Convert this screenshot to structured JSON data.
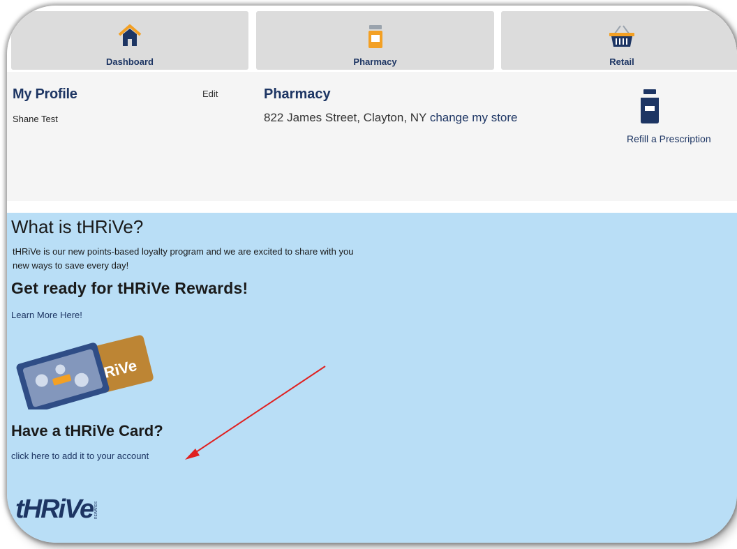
{
  "nav": {
    "dashboard": "Dashboard",
    "pharmacy": "Pharmacy",
    "retail": "Retail"
  },
  "profile": {
    "heading": "My Profile",
    "name": "Shane Test",
    "edit": "Edit"
  },
  "pharmacy": {
    "heading": "Pharmacy",
    "address": "822 James Street, Clayton, NY",
    "change_store": "change my store",
    "refill": "Refill a Prescription"
  },
  "thrive": {
    "what_heading": "What is tHRiVe?",
    "description": "tHRiVe is our new points-based loyalty program and we are excited to share with you new ways to save every day!",
    "rewards_heading": "Get ready for tHRiVe Rewards!",
    "learn_more": "Learn More Here!",
    "card_heading": "Have a tHRiVe Card?",
    "add_card": "click here to add it to your account",
    "card_image_text": "RiVe",
    "logo_text": "tHRiVe",
    "logo_sub": "REWARDS"
  },
  "colors": {
    "navy": "#1d3563",
    "blue_bg": "#b9def6",
    "orange": "#f3a024",
    "arrow": "#e02020"
  }
}
